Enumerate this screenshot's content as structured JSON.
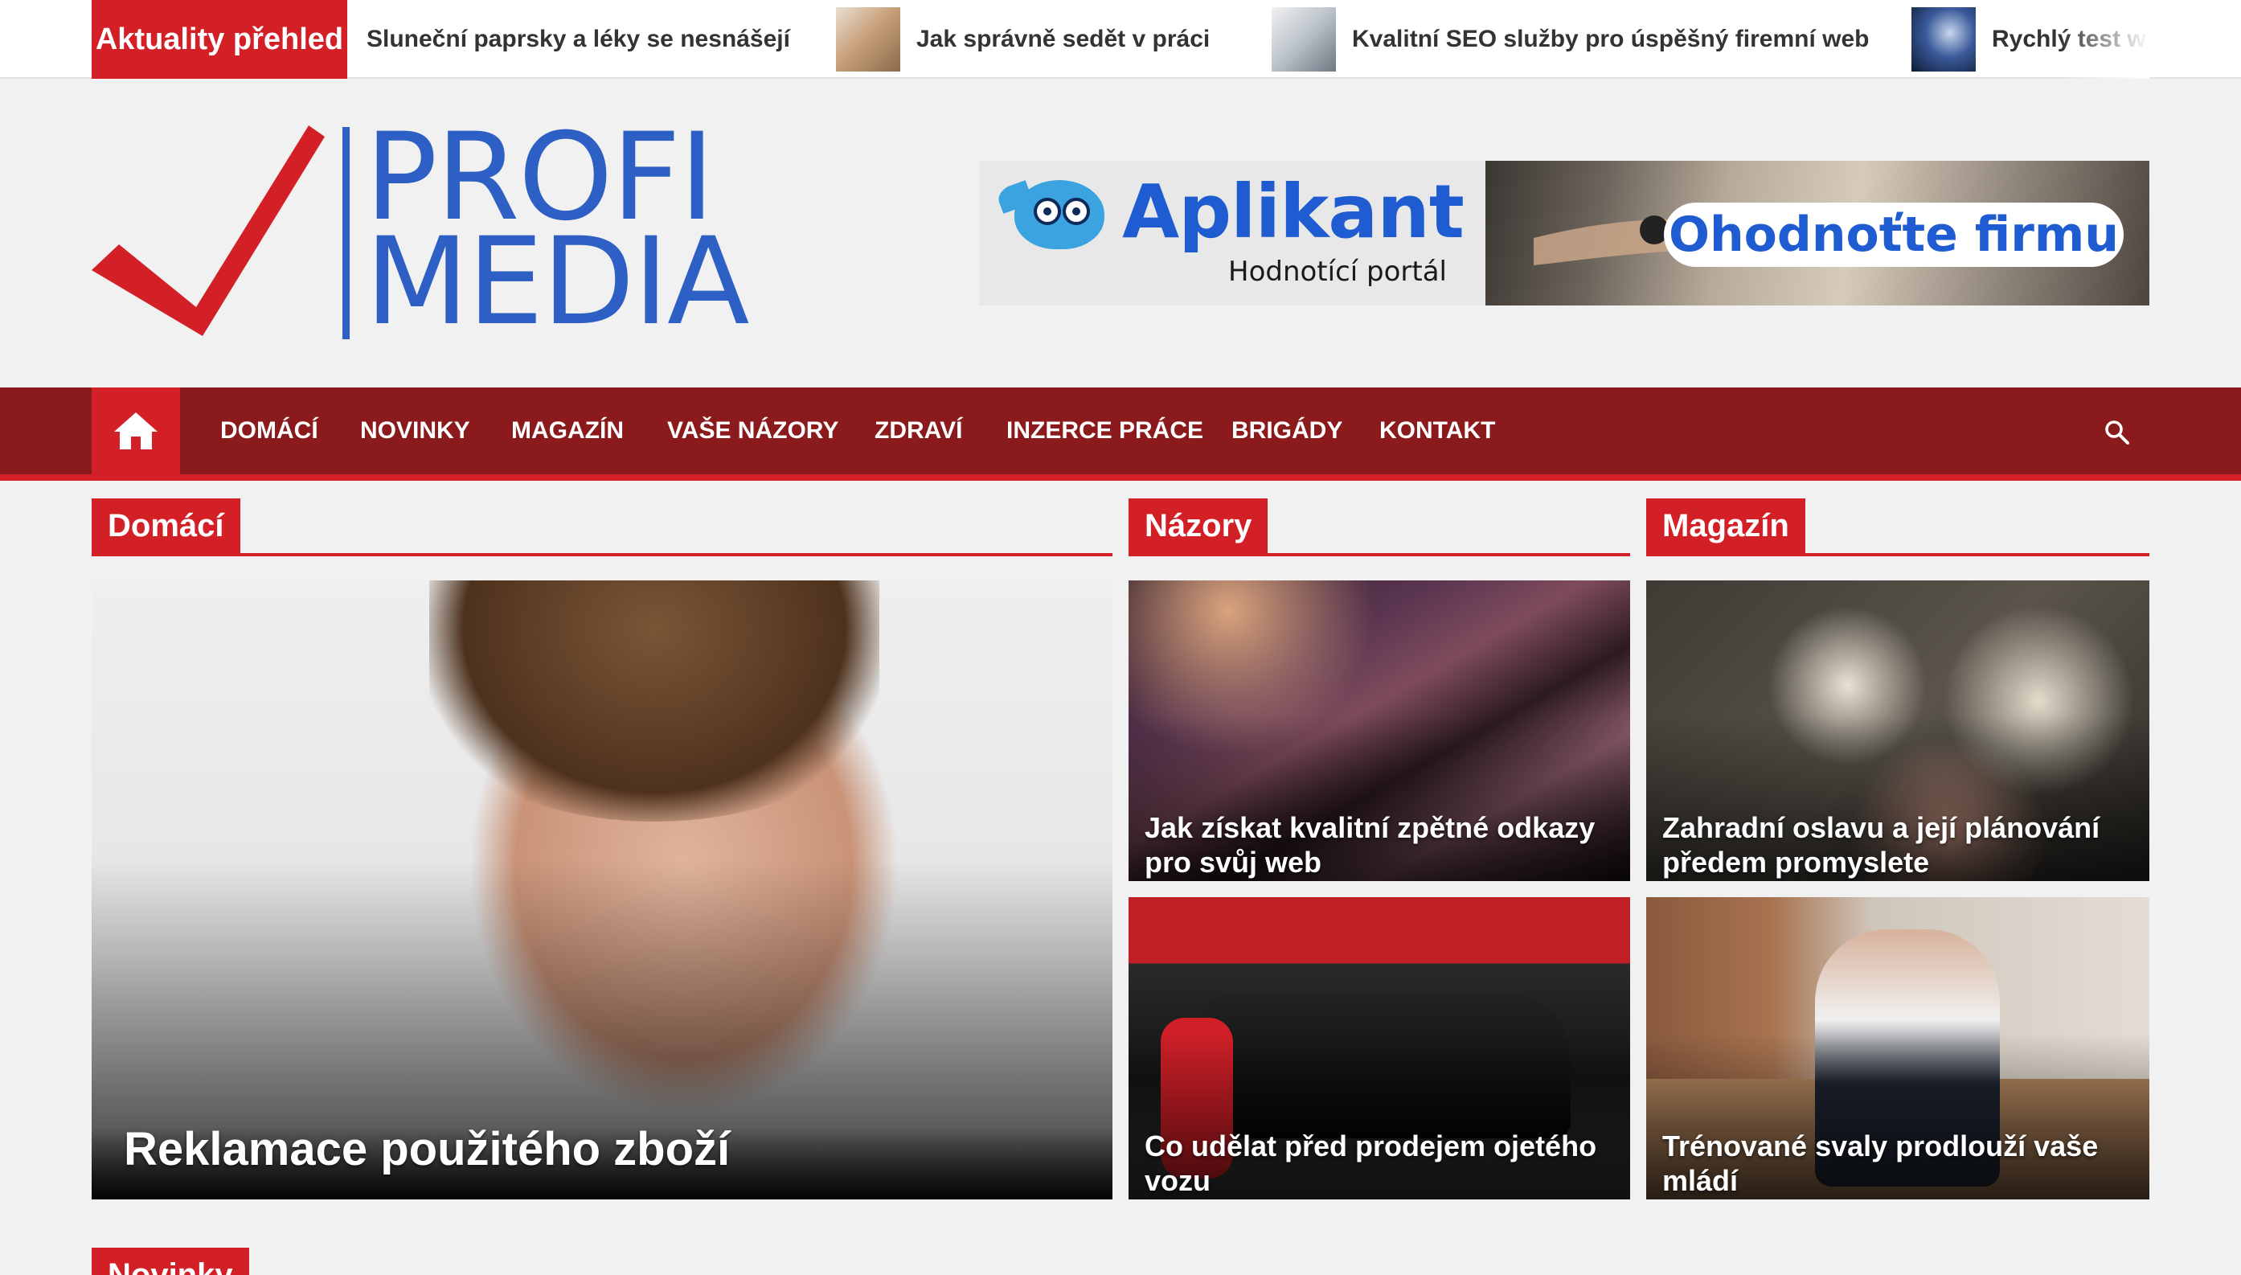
{
  "ticker": {
    "label": "Aktuality přehled",
    "items": [
      {
        "text": "Sluneční paprsky a léky se nesnášejí",
        "thumb": ""
      },
      {
        "text": "Jak správně sedět v práci",
        "thumb": "office-photo"
      },
      {
        "text": "Kvalitní SEO služby pro úspěšný firemní web",
        "thumb": "laptop-photo"
      },
      {
        "text": "Rychlý test w",
        "thumb": "globe-photo"
      }
    ]
  },
  "logo": {
    "line1": "PROFI",
    "line2": "MEDIA",
    "check_color": "#d32027",
    "text_color": "#2d5fc4"
  },
  "banner": {
    "brand": "Aplikant",
    "subtitle": "Hodnotící portál",
    "cta": "Ohodnoťte firmu"
  },
  "nav": {
    "home_icon": "home-icon",
    "items": [
      "Domácí",
      "Novinky",
      "Magazín",
      "Vaše názory",
      "Zdraví",
      "Inzerce práce",
      "Brigády",
      "Kontakt"
    ],
    "search_icon": "search-icon"
  },
  "sections": {
    "domaci": {
      "title": "Domácí",
      "featured": {
        "title": "Reklamace použitého zboží"
      }
    },
    "nazory": {
      "title": "Názory",
      "articles": [
        {
          "title": "Jak získat kvalitní zpětné odkazy pro svůj web"
        },
        {
          "title": "Co udělat před prodejem ojetého vozu"
        }
      ]
    },
    "magazin": {
      "title": "Magazín",
      "articles": [
        {
          "title": "Zahradní oslavu a její plánování předem promyslete"
        },
        {
          "title": "Trénované svaly prodlouží vaše mládí"
        }
      ]
    },
    "novinky": {
      "title": "Novinky"
    }
  },
  "colors": {
    "accent": "#d32027",
    "nav_bg": "#8a1a1b",
    "page_bg": "#f1f1f1",
    "logo_blue": "#2d5fc4"
  }
}
